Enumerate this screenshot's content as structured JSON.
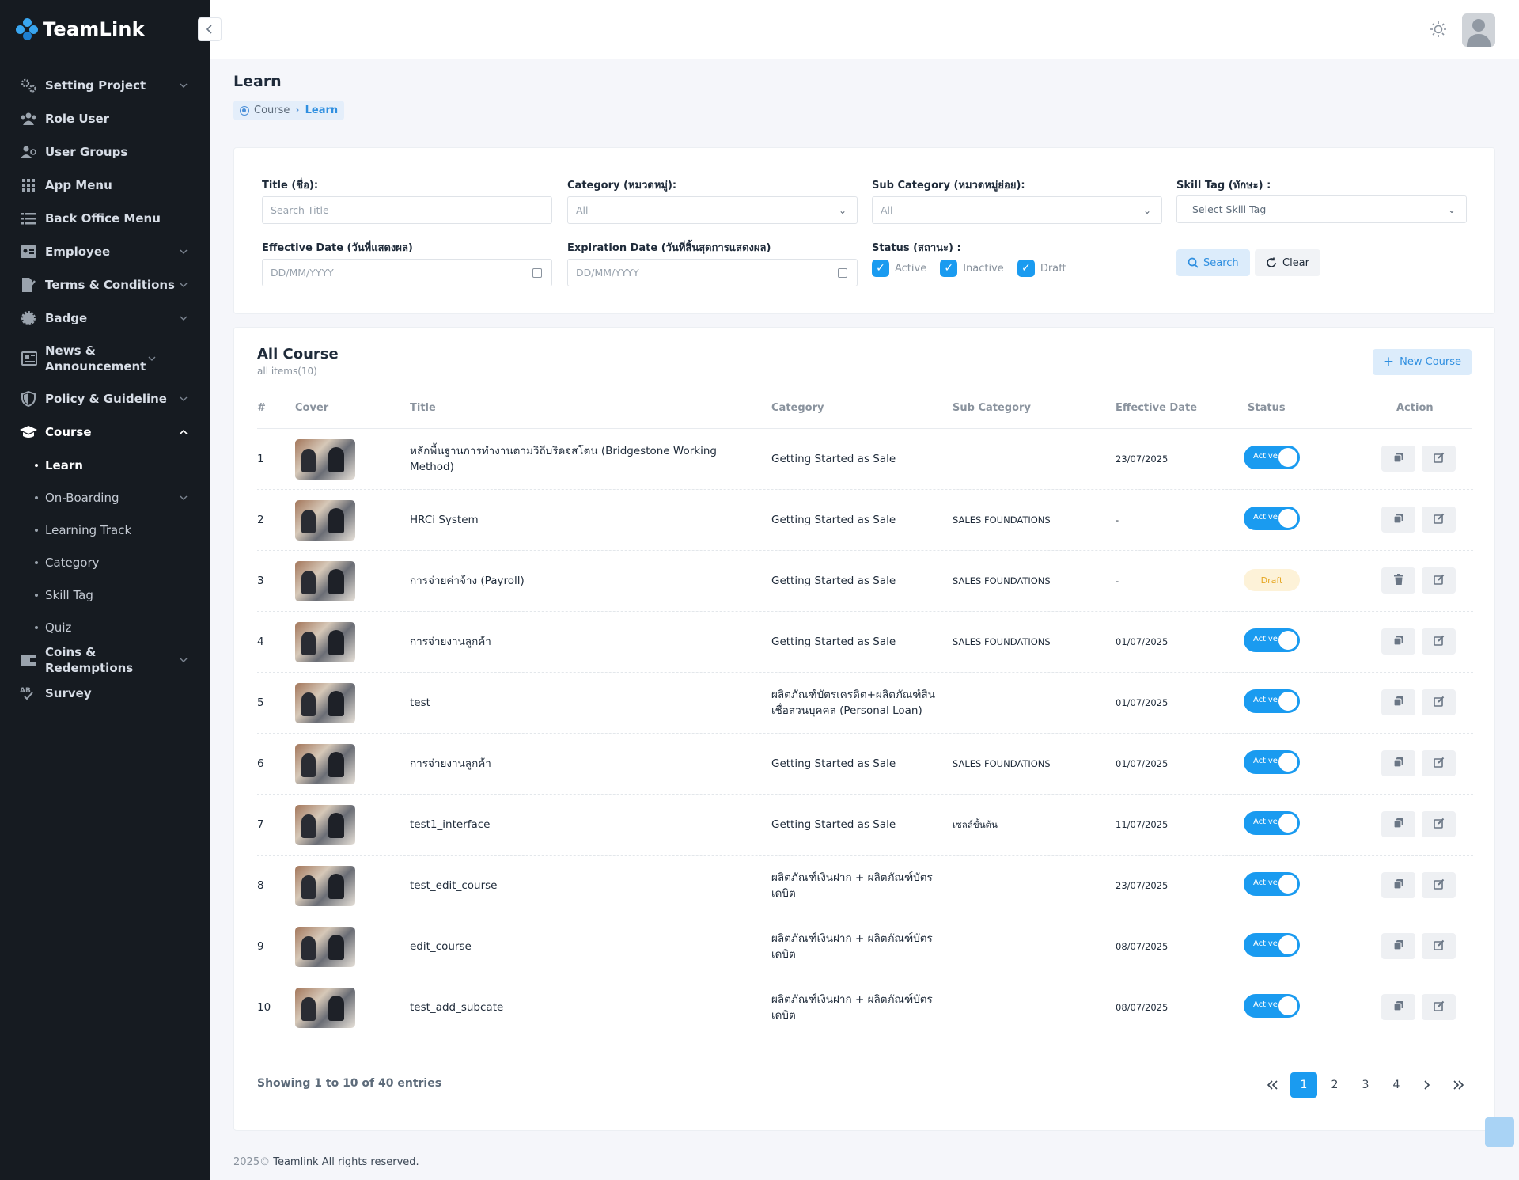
{
  "app": {
    "name": "TeamLink"
  },
  "sidebar": {
    "items": [
      {
        "label": "Setting Project",
        "icon": "gears-icon",
        "chevron": true
      },
      {
        "label": "Role User",
        "icon": "users-icon",
        "chevron": false
      },
      {
        "label": "User Groups",
        "icon": "user-group-icon",
        "chevron": false
      },
      {
        "label": "App Menu",
        "icon": "grid-icon",
        "chevron": false
      },
      {
        "label": "Back Office Menu",
        "icon": "list-icon",
        "chevron": false
      },
      {
        "label": "Employee",
        "icon": "id-card-icon",
        "chevron": true
      },
      {
        "label": "Terms & Conditions",
        "icon": "file-signature-icon",
        "chevron": true
      },
      {
        "label": "Badge",
        "icon": "badge-icon",
        "chevron": true
      },
      {
        "label": "News & Announcement",
        "icon": "newspaper-icon",
        "chevron": true
      },
      {
        "label": "Policy & Guideline",
        "icon": "shield-icon",
        "chevron": true
      },
      {
        "label": "Course",
        "icon": "graduation-cap-icon",
        "chevron": true,
        "expanded": true
      }
    ],
    "course_sub": [
      {
        "label": "Learn",
        "active": true
      },
      {
        "label": "On-Boarding",
        "chevron": true
      },
      {
        "label": "Learning Track"
      },
      {
        "label": "Category"
      },
      {
        "label": "Skill Tag"
      },
      {
        "label": "Quiz"
      }
    ],
    "items_after": [
      {
        "label": "Coins & Redemptions",
        "icon": "wallet-icon",
        "chevron": true
      },
      {
        "label": "Survey",
        "icon": "ab-test-icon",
        "chevron": false
      }
    ]
  },
  "page": {
    "title": "Learn",
    "breadcrumb": {
      "parent": "Course",
      "current": "Learn"
    }
  },
  "filters": {
    "title_label": "Title (ชื่อ):",
    "title_placeholder": "Search Title",
    "category_label": "Category (หมวดหมู่):",
    "category_value": "All",
    "subcategory_label": "Sub Category (หมวดหมู่ย่อย):",
    "subcategory_value": "All",
    "skilltag_label": "Skill Tag (ทักษะ) :",
    "skilltag_value": "Select Skill Tag",
    "effective_label": "Effective Date (วันที่แสดงผล)",
    "effective_placeholder": "DD/MM/YYYY",
    "expiration_label": "Expiration Date (วันที่สิ้นสุดการแสดงผล)",
    "expiration_placeholder": "DD/MM/YYYY",
    "status_label": "Status (สถานะ) :",
    "status_options": [
      "Active",
      "Inactive",
      "Draft"
    ],
    "search_button": "Search",
    "clear_button": "Clear"
  },
  "table": {
    "title": "All Course",
    "subtitle": "all items(10)",
    "new_button": "New Course",
    "columns": [
      "#",
      "Cover",
      "Title",
      "Category",
      "Sub Category",
      "Effective Date",
      "Status",
      "Action"
    ],
    "rows": [
      {
        "no": "1",
        "title": "หลักพื้นฐานการทำงานตามวิถีบริดจสโตน (Bridgestone Working Method)",
        "category": "Getting Started as Sale",
        "subcategory": "",
        "effective": "23/07/2025",
        "status": "Active"
      },
      {
        "no": "2",
        "title": "HRCi System",
        "category": "Getting Started as Sale",
        "subcategory": "SALES FOUNDATIONS",
        "effective": "-",
        "status": "Active"
      },
      {
        "no": "3",
        "title": "การจ่ายค่าจ้าง (Payroll)",
        "category": "Getting Started as Sale",
        "subcategory": "SALES FOUNDATIONS",
        "effective": "-",
        "status": "Draft"
      },
      {
        "no": "4",
        "title": "การจ่ายงานลูกค้า",
        "category": "Getting Started as Sale",
        "subcategory": "SALES FOUNDATIONS",
        "effective": "01/07/2025",
        "status": "Active"
      },
      {
        "no": "5",
        "title": "test",
        "category": "ผลิตภัณฑ์บัตรเครดิต+ผลิตภัณฑ์สินเชื่อส่วนบุคคล (Personal Loan)",
        "subcategory": "",
        "effective": "01/07/2025",
        "status": "Active"
      },
      {
        "no": "6",
        "title": "การจ่ายงานลูกค้า",
        "category": "Getting Started as Sale",
        "subcategory": "SALES FOUNDATIONS",
        "effective": "01/07/2025",
        "status": "Active"
      },
      {
        "no": "7",
        "title": "test1_interface",
        "category": "Getting Started as Sale",
        "subcategory": "เซลล์ขั้นต้น",
        "effective": "11/07/2025",
        "status": "Active"
      },
      {
        "no": "8",
        "title": "test_edit_course",
        "category": "ผลิตภัณฑ์เงินฝาก + ผลิตภัณฑ์บัตรเดบิต",
        "subcategory": "",
        "effective": "23/07/2025",
        "status": "Active"
      },
      {
        "no": "9",
        "title": "edit_course",
        "category": "ผลิตภัณฑ์เงินฝาก + ผลิตภัณฑ์บัตรเดบิต",
        "subcategory": "",
        "effective": "08/07/2025",
        "status": "Active"
      },
      {
        "no": "10",
        "title": "test_add_subcate",
        "category": "ผลิตภัณฑ์เงินฝาก + ผลิตภัณฑ์บัตรเดบิต",
        "subcategory": "",
        "effective": "08/07/2025",
        "status": "Active"
      }
    ],
    "showing": "Showing 1 to 10 of 40 entries",
    "pages": [
      "1",
      "2",
      "3",
      "4"
    ],
    "current_page": "1"
  },
  "footer": {
    "year": "2025©",
    "text": "Teamlink All rights reserved."
  },
  "colors": {
    "accent": "#1a9bf0",
    "sidebar_bg": "#161b21",
    "draft": "#e6a723"
  }
}
